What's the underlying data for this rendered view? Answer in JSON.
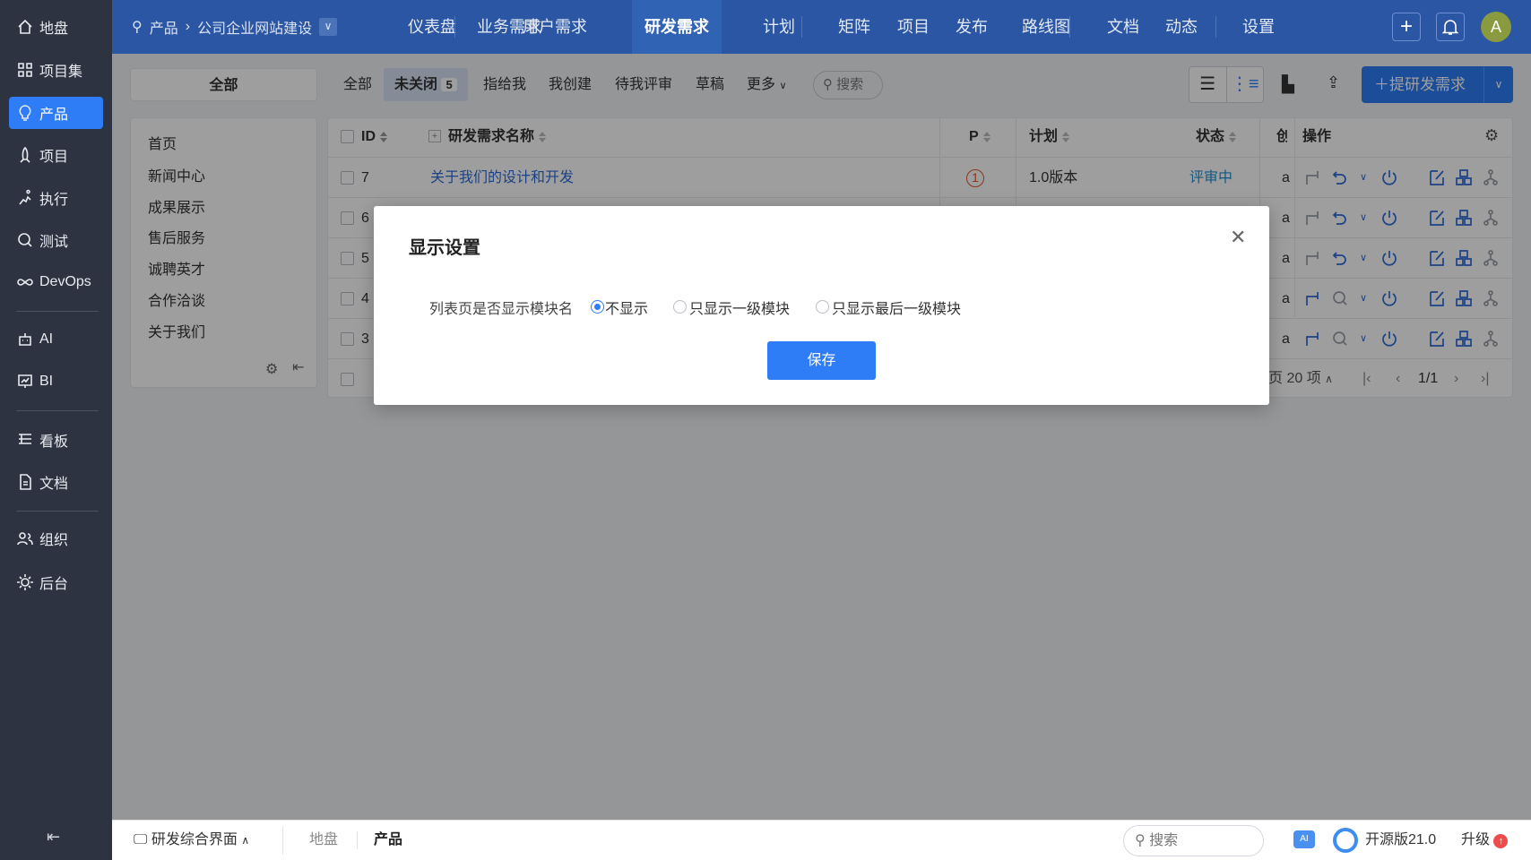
{
  "sidebar": {
    "items": [
      {
        "label": "地盘",
        "icon": "home-icon"
      },
      {
        "label": "项目集",
        "icon": "grid-icon"
      },
      {
        "label": "产品",
        "icon": "lightbulb-icon",
        "active": true
      },
      {
        "label": "项目",
        "icon": "rocket-icon"
      },
      {
        "label": "执行",
        "icon": "run-icon"
      },
      {
        "label": "测试",
        "icon": "search-bug-icon"
      },
      {
        "label": "DevOps",
        "icon": "infinity-icon"
      },
      {
        "label": "AI",
        "icon": "robot-icon"
      },
      {
        "label": "BI",
        "icon": "chart-board-icon"
      },
      {
        "label": "看板",
        "icon": "kanban-icon"
      },
      {
        "label": "文档",
        "icon": "document-icon"
      },
      {
        "label": "组织",
        "icon": "users-icon"
      },
      {
        "label": "后台",
        "icon": "gear-icon"
      }
    ],
    "collapse_icon": "collapse-left-icon"
  },
  "topbar": {
    "breadcrumb": {
      "root": "产品",
      "current": "公司企业网站建设"
    },
    "nav": [
      {
        "label": "仪表盘"
      },
      {
        "label": "业务需求"
      },
      {
        "label": "用户需求"
      },
      {
        "label": "研发需求",
        "active": true
      },
      {
        "label": "计划"
      },
      {
        "label": "矩阵"
      },
      {
        "label": "项目"
      },
      {
        "label": "发布"
      },
      {
        "label": "路线图"
      },
      {
        "label": "文档"
      },
      {
        "label": "动态"
      },
      {
        "label": "设置"
      }
    ],
    "avatar": "A",
    "colors": {
      "bar": "#2a56a3",
      "avatar": "#8a9a3e"
    }
  },
  "filter": {
    "module_all": "全部",
    "tabs": [
      {
        "label": "全部"
      },
      {
        "label": "未关闭",
        "count": "5",
        "active": true
      },
      {
        "label": "指给我"
      },
      {
        "label": "我创建"
      },
      {
        "label": "待我评审"
      },
      {
        "label": "草稿"
      },
      {
        "label": "更多"
      }
    ],
    "search_label": "搜索",
    "create_button": "提研发需求"
  },
  "modules": [
    "首页",
    "新闻中心",
    "成果展示",
    "售后服务",
    "诚聘英才",
    "合作洽谈",
    "关于我们"
  ],
  "table": {
    "headers": {
      "id": "ID",
      "name": "研发需求名称",
      "pri": "P",
      "plan": "计划",
      "status": "状态",
      "creator": "创",
      "actions": "操作"
    },
    "rows": [
      {
        "id": "7",
        "name": "关于我们的设计和开发",
        "pri": "1",
        "plan": "1.0版本",
        "status": "评审中",
        "creator": "a",
        "review": true
      },
      {
        "id": "6",
        "creator": "a",
        "review": true
      },
      {
        "id": "5",
        "creator": "a",
        "review": true
      },
      {
        "id": "4",
        "creator": "a",
        "review": false
      },
      {
        "id": "3",
        "creator": "a",
        "review": false
      }
    ],
    "footer": {
      "page_size": "页 20 项",
      "page": "1/1"
    }
  },
  "dialog": {
    "title": "显示设置",
    "label": "列表页是否显示模块名",
    "options": [
      {
        "label": "不显示",
        "selected": true
      },
      {
        "label": "只显示一级模块"
      },
      {
        "label": "只显示最后一级模块"
      }
    ],
    "save": "保存"
  },
  "bottombar": {
    "app": "研发综合界面",
    "crumbs": [
      "地盘",
      "产品"
    ],
    "search": "搜索",
    "version": "开源版21.0",
    "upgrade": "升级"
  },
  "colors": {
    "primary": "#2e7cf6",
    "status": "#1f8fd6",
    "priority": "#e0582c"
  }
}
